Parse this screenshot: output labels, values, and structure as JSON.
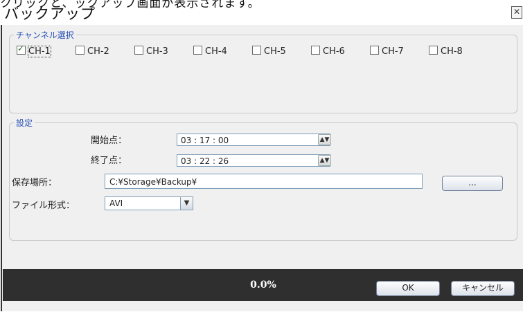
{
  "top_fragment": "クリックと、ックアップ画面が表示されます。",
  "window": {
    "title": "バックアップ",
    "close_glyph": "✕"
  },
  "channel_group": {
    "legend": "チャンネル選択",
    "channels": [
      {
        "label": "CH-1",
        "checked": true
      },
      {
        "label": "CH-2",
        "checked": false
      },
      {
        "label": "CH-3",
        "checked": false
      },
      {
        "label": "CH-4",
        "checked": false
      },
      {
        "label": "CH-5",
        "checked": false
      },
      {
        "label": "CH-6",
        "checked": false
      },
      {
        "label": "CH-7",
        "checked": false
      },
      {
        "label": "CH-8",
        "checked": false
      }
    ]
  },
  "settings": {
    "legend": "設定",
    "start_label": "開始点：",
    "start_value": "03 : 17 : 00",
    "end_label": "終了点：",
    "end_value": "03 : 22 : 26",
    "save_label": "保存場所：",
    "save_path": "C:¥Storage¥Backup¥",
    "browse_label": "...",
    "format_label": "ファイル形式：",
    "format_value": "AVI",
    "spin_icon": "spinner-icon"
  },
  "progress": {
    "value": 0.0,
    "text": "0.0%",
    "bar_color": "#2f2f2f",
    "fill_color": "#5a3ea0"
  },
  "buttons": {
    "ok": "OK",
    "cancel": "キャンセル"
  }
}
